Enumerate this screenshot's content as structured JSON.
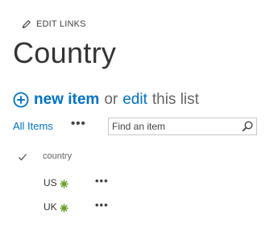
{
  "toolbar": {
    "edit_links_label": "EDIT LINKS",
    "edit_icon": "pencil-icon"
  },
  "page": {
    "title": "Country"
  },
  "commands": {
    "plus_icon": "plus-circle-icon",
    "new_item_label": "new item",
    "or_text": "or",
    "edit_label": "edit",
    "this_list_text": "this list"
  },
  "view": {
    "current_view_label": "All Items",
    "more_label": "•••",
    "search": {
      "placeholder": "Find an item",
      "icon": "search-icon"
    }
  },
  "list": {
    "select_all_icon": "checkmark-icon",
    "columns": [
      {
        "label": "country"
      }
    ],
    "items": [
      {
        "title": "US",
        "badge_icon": "new-item-icon",
        "more_label": "•••"
      },
      {
        "title": "UK",
        "badge_icon": "new-item-icon",
        "more_label": "•••"
      }
    ]
  },
  "colors": {
    "accent": "#0072c6",
    "new_badge": "#6a9a1f",
    "text": "#333333",
    "muted": "#666666"
  }
}
